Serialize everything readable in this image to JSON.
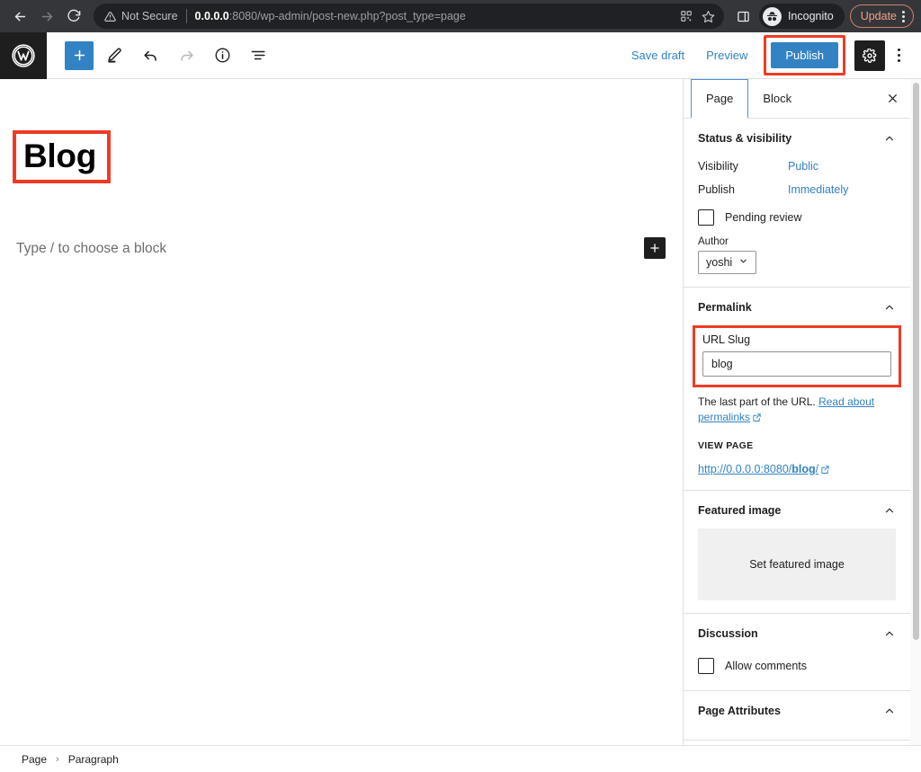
{
  "browser": {
    "back_icon": "arrow-left-icon",
    "forward_icon": "arrow-right-icon",
    "reload_icon": "reload-icon",
    "security_label": "Not Secure",
    "security_icon": "warning-triangle-icon",
    "url_host": "0.0.0.0",
    "url_rest": ":8080/wp-admin/post-new.php?post_type=page",
    "qr_icon": "qr-code-icon",
    "bookmark_icon": "star-icon",
    "side_panel_icon": "side-panel-icon",
    "profile_icon": "incognito-icon",
    "profile_label": "Incognito",
    "update_label": "Update",
    "menu_icon": "kebab-menu-icon"
  },
  "toolbar": {
    "logo_icon": "wordpress-logo-icon",
    "add_block_icon": "plus-icon",
    "tools_icon": "pencil-icon",
    "undo_icon": "undo-icon",
    "redo_icon": "redo-icon",
    "details_icon": "info-circle-icon",
    "list_view_icon": "list-view-icon",
    "save_draft_label": "Save draft",
    "preview_label": "Preview",
    "publish_label": "Publish",
    "settings_icon": "gear-icon",
    "options_icon": "kebab-menu-icon"
  },
  "editor": {
    "post_title": "Blog",
    "paragraph_placeholder": "Type / to choose a block",
    "inserter_icon": "plus-icon"
  },
  "sidebar": {
    "tabs": [
      {
        "label": "Page",
        "active": true
      },
      {
        "label": "Block",
        "active": false
      }
    ],
    "close_icon": "close-icon",
    "status_visibility": {
      "title": "Status & visibility",
      "collapse_icon": "chevron-up-icon",
      "visibility_label": "Visibility",
      "visibility_value": "Public",
      "publish_label": "Publish",
      "publish_value": "Immediately",
      "pending_review_label": "Pending review",
      "author_label": "Author",
      "author_value": "yoshi",
      "author_chevron_icon": "chevron-down-icon"
    },
    "permalink": {
      "title": "Permalink",
      "collapse_icon": "chevron-up-icon",
      "slug_label": "URL Slug",
      "slug_value": "blog",
      "help_prefix": "The last part of the URL. ",
      "help_link": "Read about permalinks",
      "external_link_icon": "external-link-icon",
      "view_page_label": "VIEW PAGE",
      "view_page_url_prefix": "http://0.0.0.0:8080/",
      "view_page_url_slug": "blog",
      "view_page_url_suffix": "/"
    },
    "featured_image": {
      "title": "Featured image",
      "collapse_icon": "chevron-up-icon",
      "set_button_label": "Set featured image"
    },
    "discussion": {
      "title": "Discussion",
      "collapse_icon": "chevron-up-icon",
      "allow_comments_label": "Allow comments"
    },
    "page_attributes": {
      "title": "Page Attributes",
      "collapse_icon": "chevron-up-icon"
    }
  },
  "statusbar": {
    "crumb_root": "Page",
    "crumb_separator": "›",
    "crumb_leaf": "Paragraph"
  }
}
